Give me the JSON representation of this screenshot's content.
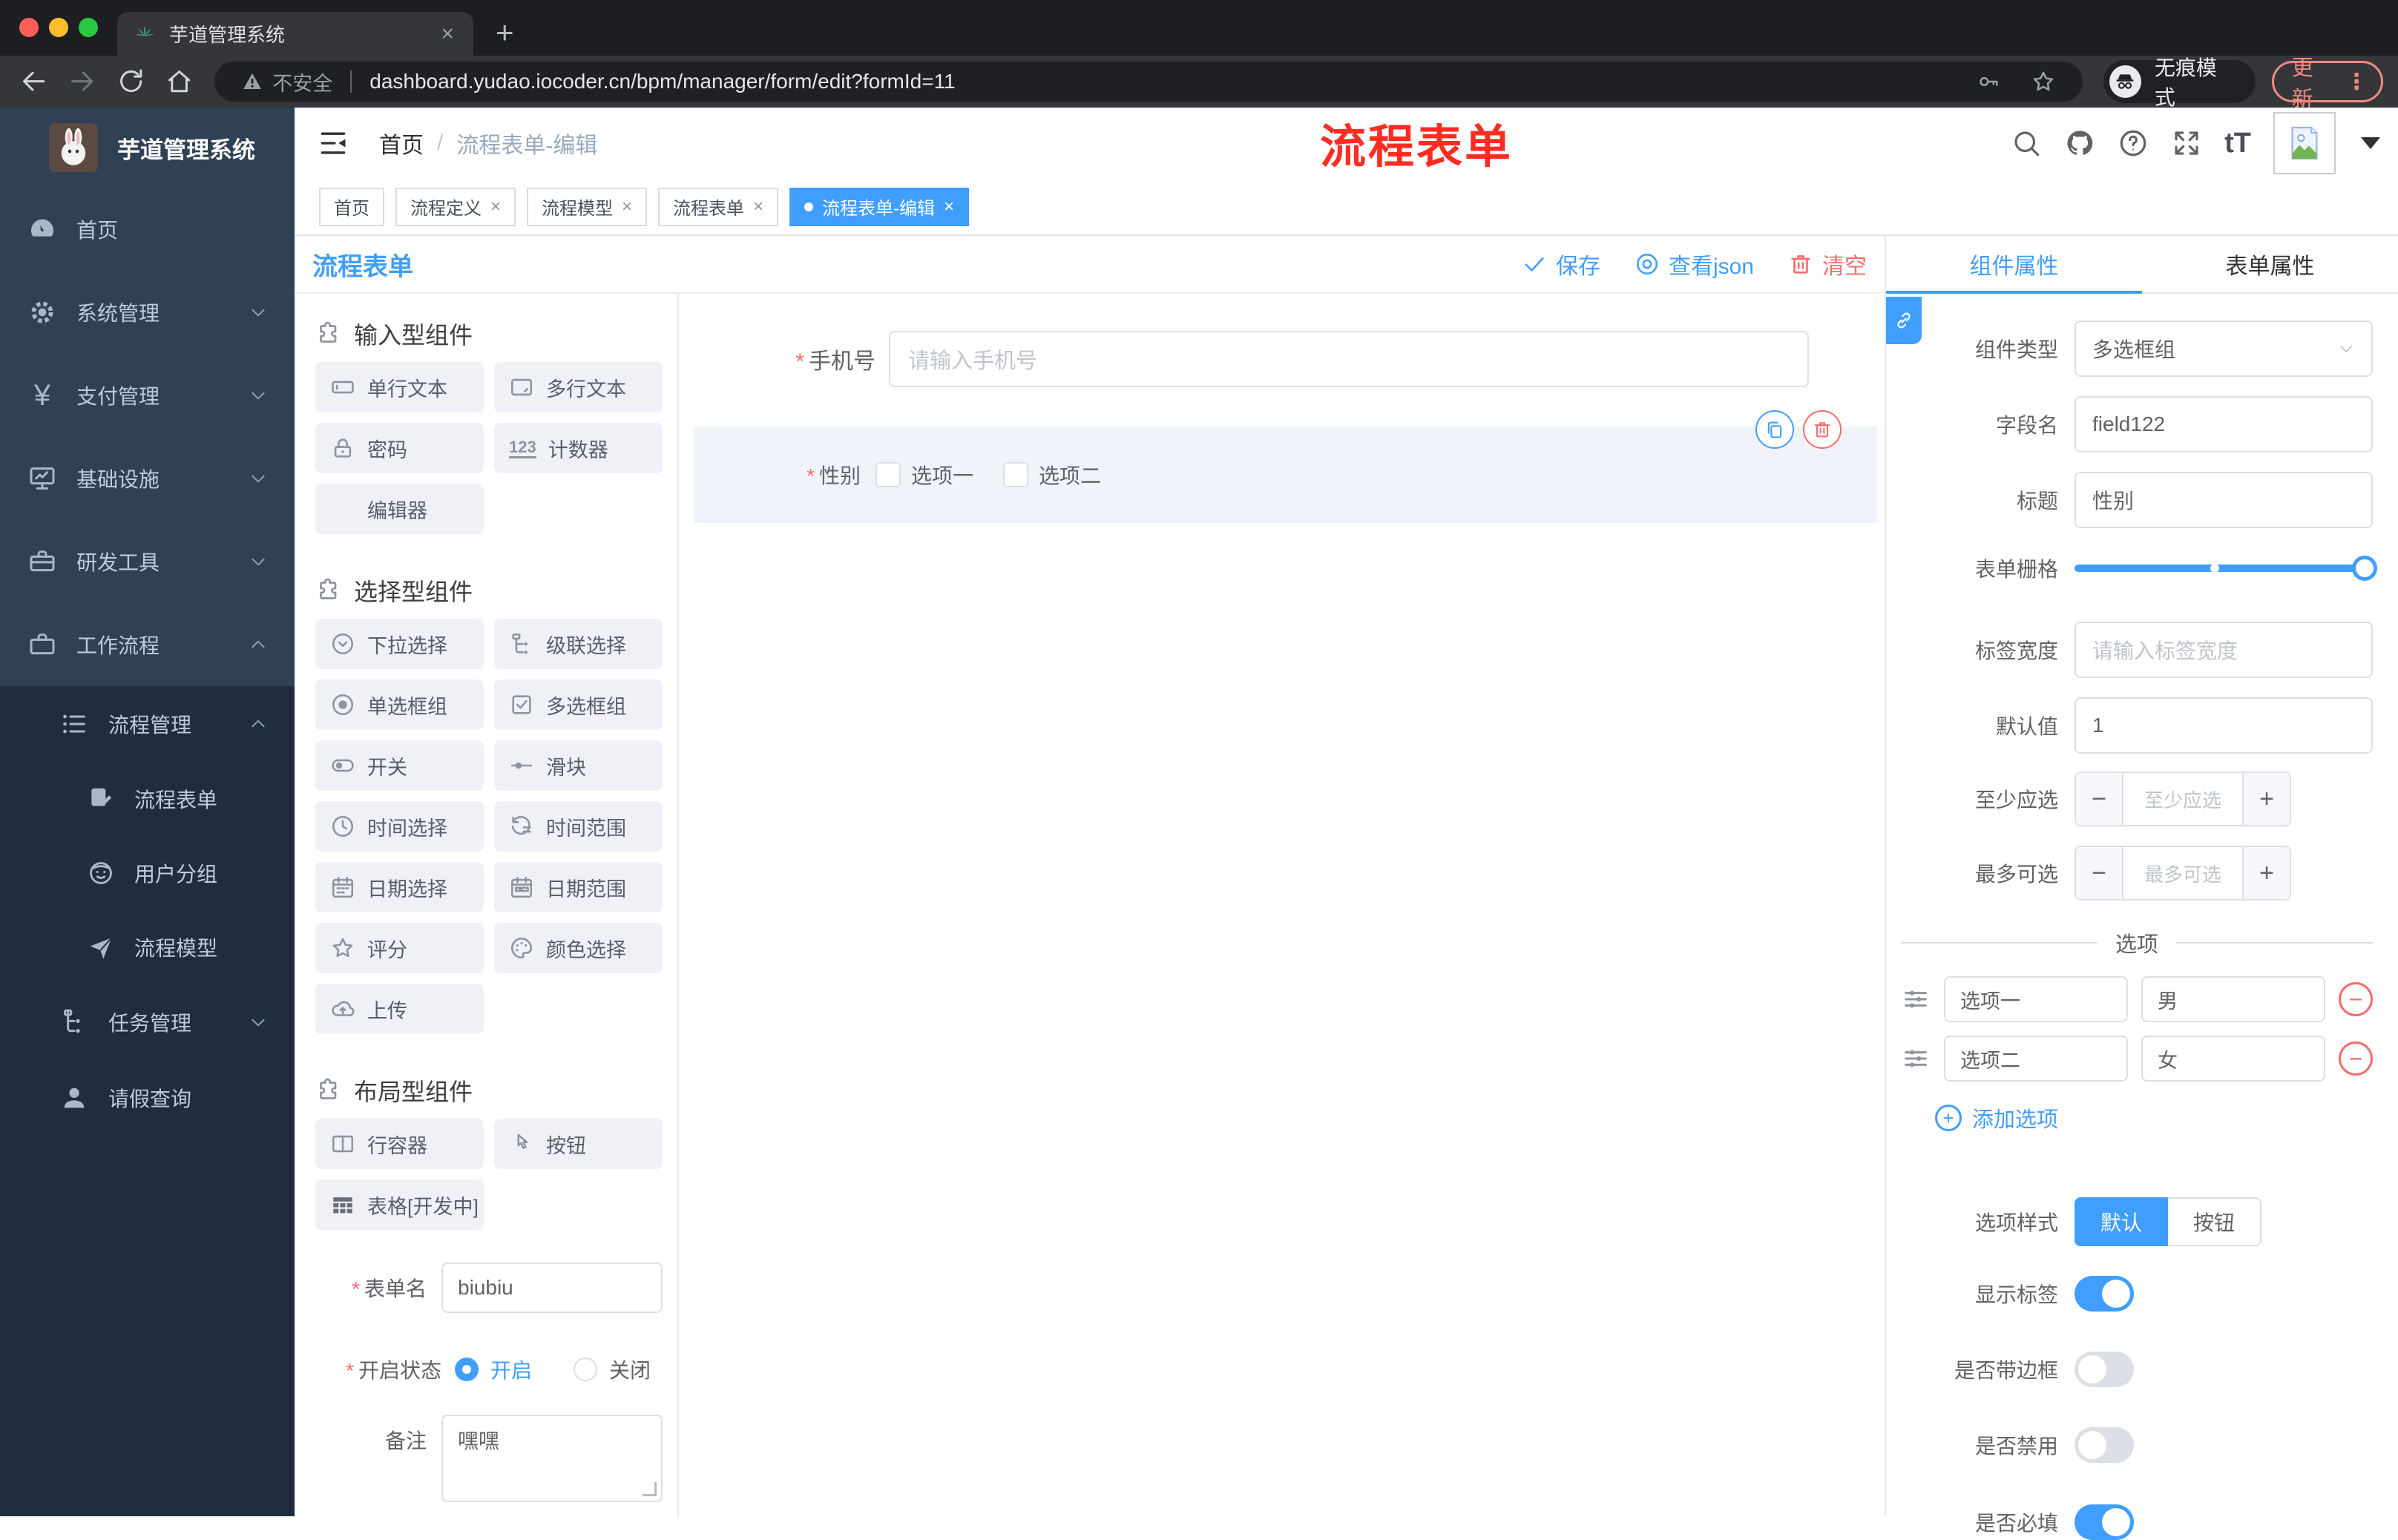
{
  "chrome": {
    "tab_title": "芋道管理系统",
    "close_glyph": "×",
    "new_tab_glyph": "+",
    "security_label": "不安全",
    "url": "dashboard.yudao.iocoder.cn/bpm/manager/form/edit?formId=11",
    "incognito_label": "无痕模式",
    "update_label": "更新",
    "menu_glyph": "⋮"
  },
  "annotation": {
    "text": "流程表单"
  },
  "sidebar": {
    "app_title": "芋道管理系统",
    "home": "首页",
    "system": "系统管理",
    "payment": "支付管理",
    "infra": "基础设施",
    "devtools": "研发工具",
    "workflow": "工作流程",
    "process_mgmt": "流程管理",
    "process_form": "流程表单",
    "user_group": "用户分组",
    "process_model": "流程模型",
    "task_mgmt": "任务管理",
    "leave_query": "请假查询"
  },
  "header": {
    "breadcrumb_home": "首页",
    "separator": "/",
    "breadcrumb_current": "流程表单-编辑",
    "font_glyph": "tT"
  },
  "tags": {
    "close_glyph": "×",
    "items": [
      {
        "label": "首页"
      },
      {
        "label": "流程定义"
      },
      {
        "label": "流程模型"
      },
      {
        "label": "流程表单"
      },
      {
        "label": "流程表单-编辑"
      }
    ]
  },
  "designer": {
    "title": "流程表单",
    "save": "保存",
    "view_json": "查看json",
    "clear": "清空"
  },
  "components": {
    "required_mark": "*",
    "input_title": "输入型组件",
    "input_items": [
      "单行文本",
      "多行文本",
      "密码",
      "计数器",
      "编辑器"
    ],
    "counter_glyph": "123",
    "select_title": "选择型组件",
    "select_items": [
      "下拉选择",
      "级联选择",
      "单选框组",
      "多选框组",
      "开关",
      "滑块",
      "时间选择",
      "时间范围",
      "日期选择",
      "日期范围",
      "评分",
      "颜色选择",
      "上传"
    ],
    "layout_title": "布局型组件",
    "layout_items": [
      "行容器",
      "按钮",
      "表格[开发中]"
    ],
    "form": {
      "name_label": "表单名",
      "name_value": "biubiu",
      "status_label": "开启状态",
      "status_on": "开启",
      "status_off": "关闭",
      "remark_label": "备注",
      "remark_value": "嘿嘿"
    }
  },
  "canvas": {
    "phone_label": "手机号",
    "phone_placeholder": "请输入手机号",
    "gender_label": "性别",
    "gender_option1": "选项一",
    "gender_option2": "选项二"
  },
  "props": {
    "tab_component": "组件属性",
    "tab_form": "表单属性",
    "type_label": "组件类型",
    "type_value": "多选框组",
    "field_label": "字段名",
    "field_value": "field122",
    "title_label": "标题",
    "title_value": "性别",
    "grid_label": "表单栅格",
    "label_width_label": "标签宽度",
    "label_width_placeholder": "请输入标签宽度",
    "default_label": "默认值",
    "default_value": "1",
    "min_label": "至少应选",
    "min_placeholder": "至少应选",
    "max_label": "最多可选",
    "max_placeholder": "最多可选",
    "minus_glyph": "−",
    "plus_glyph": "+",
    "options_title": "选项",
    "options": [
      {
        "label": "选项一",
        "value": "男"
      },
      {
        "label": "选项二",
        "value": "女"
      }
    ],
    "add_option": "添加选项",
    "style_label": "选项样式",
    "style_default": "默认",
    "style_button": "按钮",
    "show_tag_label": "显示标签",
    "border_label": "是否带边框",
    "disabled_label": "是否禁用",
    "required_label": "是否必填"
  },
  "colors": {
    "primary": "#409eff",
    "danger": "#f56c6c",
    "annotation_red": "#fe2c23",
    "sidebar_bg": "#304156",
    "submenu_bg": "#1f2d3d"
  }
}
